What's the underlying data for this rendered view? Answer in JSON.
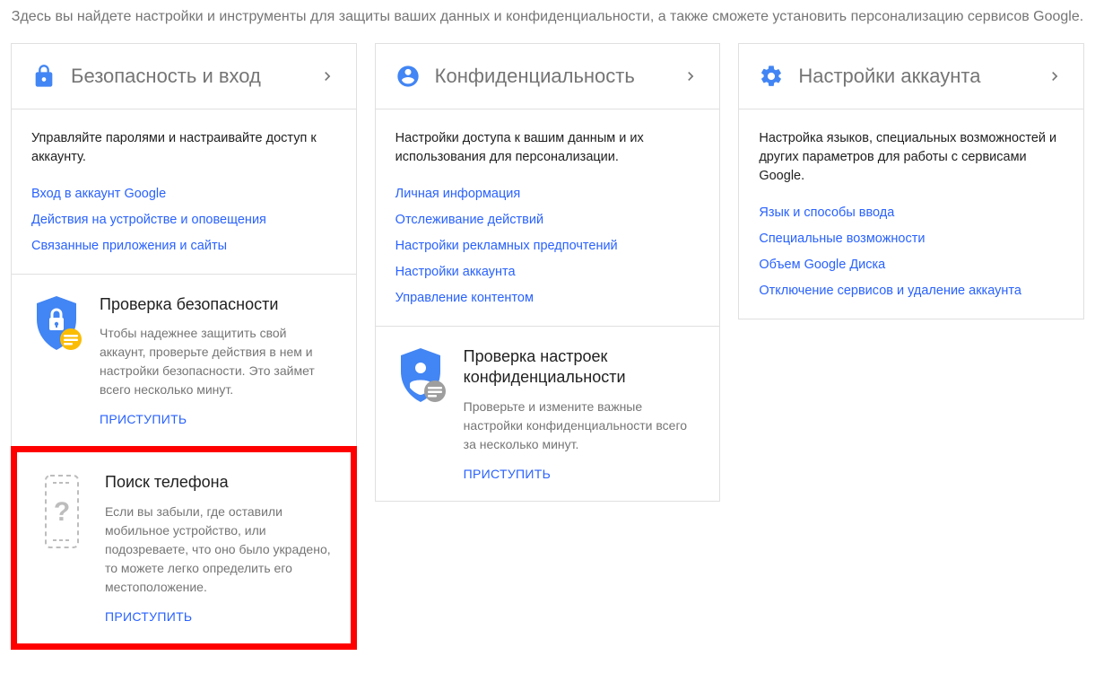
{
  "intro": "Здесь вы найдете настройки и инструменты для защиты ваших данных и конфиденциальности, а также сможете установить персонализацию сервисов Google.",
  "columns": {
    "security": {
      "title": "Безопасность и вход",
      "desc": "Управляйте паролями и настраивайте доступ к аккаунту.",
      "links": [
        "Вход в аккаунт Google",
        "Действия на устройстве и оповещения",
        "Связанные приложения и сайты"
      ],
      "checkup": {
        "title": "Проверка безопасности",
        "desc": "Чтобы надежнее защитить свой аккаунт, проверьте действия в нем и настройки безопасности. Это займет всего несколько минут.",
        "cta": "ПРИСТУПИТЬ"
      },
      "findphone": {
        "title": "Поиск телефона",
        "desc": "Если вы забыли, где оставили мобильное устройство, или подозреваете, что оно было украдено, то можете легко определить его местоположение.",
        "cta": "ПРИСТУПИТЬ"
      }
    },
    "privacy": {
      "title": "Конфиденциальность",
      "desc": "Настройки доступа к вашим данным и их использования для персонализации.",
      "links": [
        "Личная информация",
        "Отслеживание действий",
        "Настройки рекламных предпочтений",
        "Настройки аккаунта",
        "Управление контентом"
      ],
      "checkup": {
        "title": "Проверка настроек конфиденциальности",
        "desc": "Проверьте и измените важные настройки конфиденциальности всего за несколько минут.",
        "cta": "ПРИСТУПИТЬ"
      }
    },
    "settings": {
      "title": "Настройки аккаунта",
      "desc": "Настройка языков, специальных возможностей и других параметров для работы с сервисами Google.",
      "links": [
        "Язык и способы ввода",
        "Специальные возможности",
        "Объем Google Диска",
        "Отключение сервисов и удаление аккаунта"
      ]
    }
  }
}
